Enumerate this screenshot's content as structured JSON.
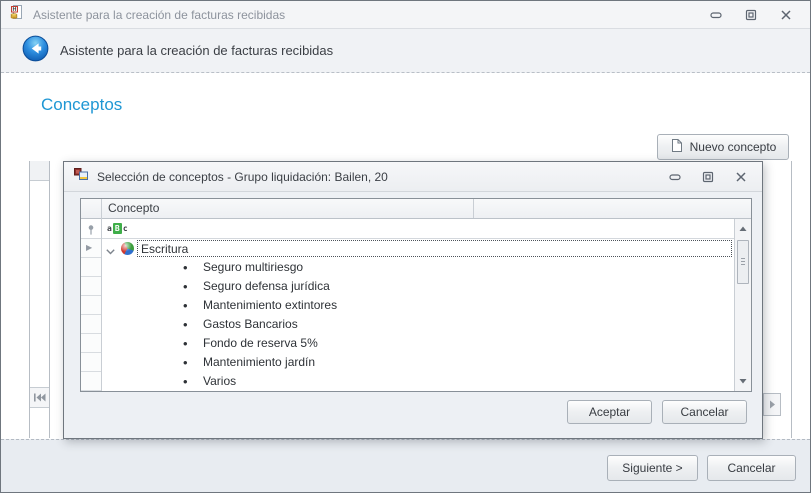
{
  "app": {
    "title": "Asistente para la creación de facturas recibidas"
  },
  "wizard": {
    "header_title": "Asistente para la creación de facturas recibidas",
    "section_heading": "Conceptos",
    "new_concept_button": "Nuevo concepto",
    "next_button": "Siguiente >",
    "cancel_button": "Cancelar"
  },
  "modal": {
    "title": "Selección de conceptos - Grupo liquidación: Bailen, 20",
    "grid": {
      "column_header": "Concepto",
      "filter_abc": {
        "a": "a",
        "b": "B",
        "c": "c"
      },
      "group_label": "Escritura",
      "items": [
        "Seguro multiriesgo",
        "Seguro defensa jurídica",
        "Mantenimiento extintores",
        "Gastos Bancarios",
        "Fondo de reserva 5%",
        "Mantenimiento jardín",
        "Varios"
      ]
    },
    "accept_button": "Aceptar",
    "cancel_button": "Cancelar"
  },
  "icons": {
    "bullet": "•",
    "row_indicator": "▶",
    "app_letter": "H"
  },
  "colors": {
    "accent_blue": "#1f97d4",
    "filter_green": "#3fae49",
    "back_button_blue": "#1670c8"
  }
}
